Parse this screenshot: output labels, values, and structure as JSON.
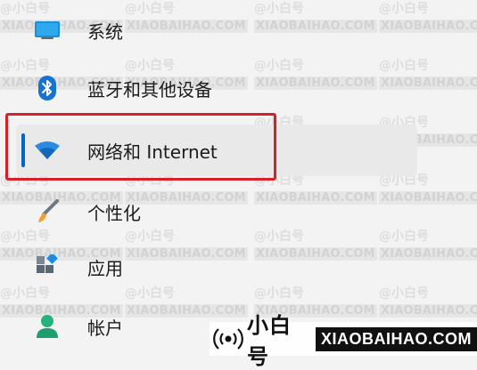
{
  "nav": {
    "items": [
      {
        "label": "系统",
        "icon": "system-display-icon"
      },
      {
        "label": "蓝牙和其他设备",
        "icon": "bluetooth-icon"
      },
      {
        "label": "网络和 Internet",
        "icon": "wifi-icon",
        "selected": true
      },
      {
        "label": "个性化",
        "icon": "paint-brush-icon"
      },
      {
        "label": "应用",
        "icon": "apps-icon"
      },
      {
        "label": "帐户",
        "icon": "account-icon"
      }
    ]
  },
  "watermark": {
    "top_text": "@小白号",
    "bottom_text": "XIAOBAIHAO.COM"
  },
  "brand": {
    "cn": "小白号",
    "en": "XIAOBAIHAO.COM"
  },
  "colors": {
    "accent": "#0067c0",
    "highlight_border": "#d8202a",
    "background": "#f3f3f3"
  }
}
